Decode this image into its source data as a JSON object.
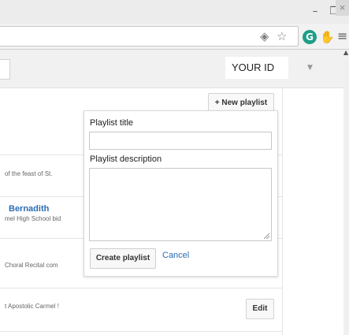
{
  "window": {
    "minimize_glyph": "–",
    "restore_glyph": "❐",
    "close_glyph": "×"
  },
  "toolbar": {
    "icons": [
      "eye-icon",
      "star-icon",
      "grammarly-icon",
      "extension-hand-icon",
      "menu-icon"
    ],
    "accent_colors": {
      "grammarly": "#1f9e87",
      "extension": "#f5a31a"
    }
  },
  "header": {
    "your_id": "YOUR ID"
  },
  "content": {
    "new_playlist_label": "+ New playlist",
    "rows": [
      {
        "snippet": "of the feast of St."
      },
      {
        "title": "Bernadith",
        "snippet": "mel High School bid"
      },
      {
        "snippet": "Choral Recital com"
      },
      {
        "snippet": "t Apostolic Carmel !",
        "edit_label": "Edit"
      }
    ]
  },
  "popup": {
    "title_label": "Playlist title",
    "title_value": "",
    "description_label": "Playlist description",
    "description_value": "",
    "create_label": "Create playlist",
    "cancel_label": "Cancel"
  }
}
